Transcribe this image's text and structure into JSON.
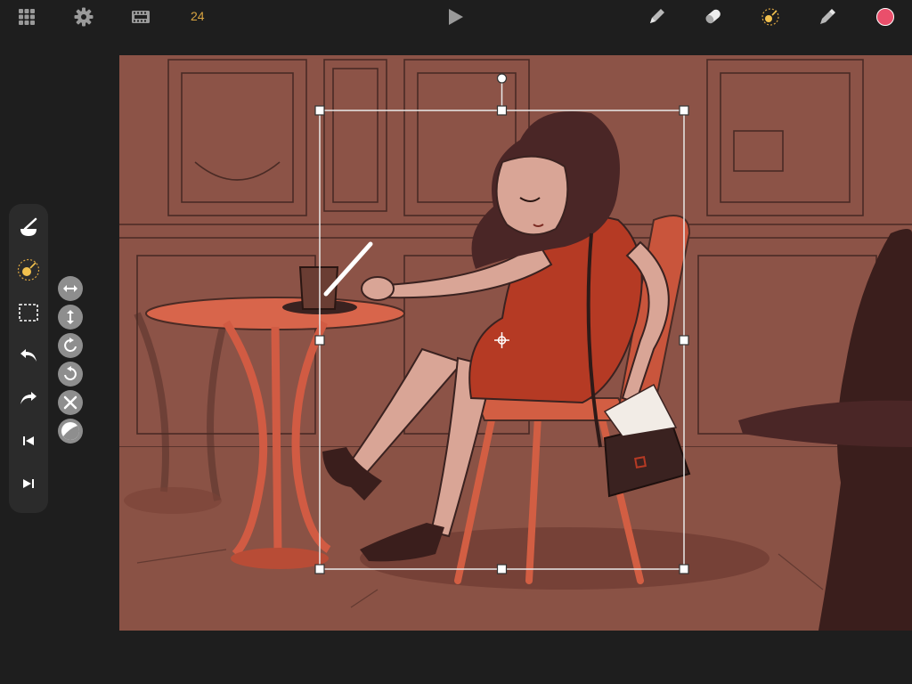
{
  "toolbar": {
    "frame_rate": "24",
    "icons": [
      "grid-icon",
      "gear-icon",
      "film-strip-icon",
      "play-icon",
      "pencil-icon",
      "eraser-icon",
      "sparkle-brush-icon",
      "eyedropper-icon",
      "color-swatch"
    ],
    "color_swatch": "#ea4f6b",
    "accent_color": "#d9a441"
  },
  "left_tools": [
    "brush-tool-icon",
    "transform-tool-icon",
    "selection-tool-icon",
    "undo-icon",
    "redo-icon",
    "previous-frame-icon",
    "next-frame-icon"
  ],
  "transform_options": [
    "flip-horizontal-icon",
    "flip-vertical-icon",
    "rotate-clockwise-icon",
    "rotate-counterclockwise-icon",
    "reset-transform-icon",
    "half-circle-icon"
  ]
}
